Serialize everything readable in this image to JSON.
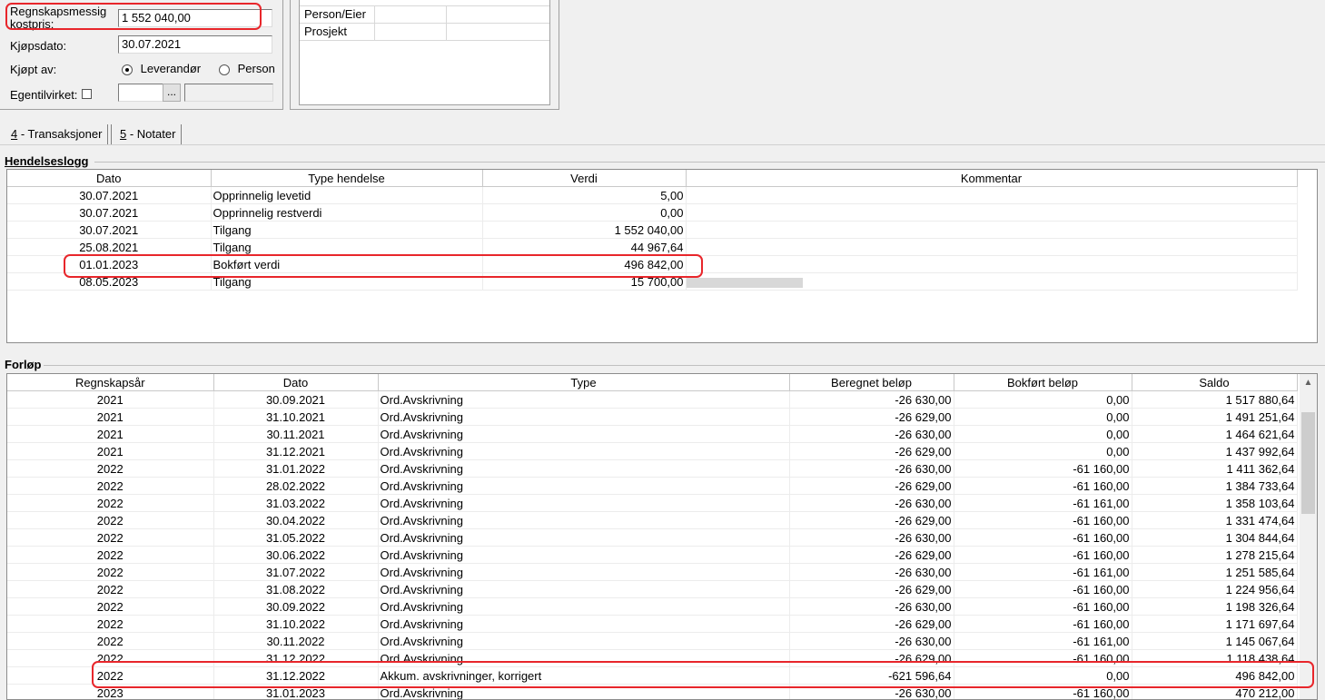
{
  "form": {
    "kostpris_label": "Regnskapsmessig kostpris:",
    "kostpris_value": "1 552 040,00",
    "kjopsdato_label": "Kjøpsdato:",
    "kjopsdato_value": "30.07.2021",
    "kjopt_av_label": "Kjøpt av:",
    "radio_leverandor": "Leverandør",
    "radio_person": "Person",
    "egentilvirket_label": "Egentilvirket:",
    "browse_button": "..."
  },
  "dimensions": {
    "rows": [
      {
        "label": "Person/Eier",
        "value": ""
      },
      {
        "label": "Prosjekt",
        "value": ""
      }
    ]
  },
  "tabs": [
    {
      "key": "4",
      "rest": " - Transaksjoner"
    },
    {
      "key": "5",
      "rest": " - Notater"
    }
  ],
  "hendelseslogg": {
    "title": "Hendelseslogg",
    "columns": [
      "Dato",
      "Type hendelse",
      "Verdi",
      "Kommentar"
    ],
    "rows": [
      {
        "dato": "30.07.2021",
        "type": "Opprinnelig levetid",
        "verdi": "5,00",
        "kommentar": ""
      },
      {
        "dato": "30.07.2021",
        "type": "Opprinnelig restverdi",
        "verdi": "0,00",
        "kommentar": ""
      },
      {
        "dato": "30.07.2021",
        "type": "Tilgang",
        "verdi": "1 552 040,00",
        "kommentar": ""
      },
      {
        "dato": "25.08.2021",
        "type": "Tilgang",
        "verdi": "44 967,64",
        "kommentar": ""
      },
      {
        "dato": "01.01.2023",
        "type": "Bokført verdi",
        "verdi": "496 842,00",
        "kommentar": ""
      },
      {
        "dato": "08.05.2023",
        "type": "Tilgang",
        "verdi": "15 700,00",
        "kommentar": ""
      }
    ]
  },
  "forlop": {
    "title": "Forløp",
    "columns": [
      "Regnskapsår",
      "Dato",
      "Type",
      "Beregnet beløp",
      "Bokført beløp",
      "Saldo"
    ],
    "rows": [
      {
        "ar": "2021",
        "dato": "30.09.2021",
        "type": "Ord.Avskrivning",
        "beregnet": "-26 630,00",
        "bokfort": "0,00",
        "saldo": "1 517 880,64"
      },
      {
        "ar": "2021",
        "dato": "31.10.2021",
        "type": "Ord.Avskrivning",
        "beregnet": "-26 629,00",
        "bokfort": "0,00",
        "saldo": "1 491 251,64"
      },
      {
        "ar": "2021",
        "dato": "30.11.2021",
        "type": "Ord.Avskrivning",
        "beregnet": "-26 630,00",
        "bokfort": "0,00",
        "saldo": "1 464 621,64"
      },
      {
        "ar": "2021",
        "dato": "31.12.2021",
        "type": "Ord.Avskrivning",
        "beregnet": "-26 629,00",
        "bokfort": "0,00",
        "saldo": "1 437 992,64"
      },
      {
        "ar": "2022",
        "dato": "31.01.2022",
        "type": "Ord.Avskrivning",
        "beregnet": "-26 630,00",
        "bokfort": "-61 160,00",
        "saldo": "1 411 362,64"
      },
      {
        "ar": "2022",
        "dato": "28.02.2022",
        "type": "Ord.Avskrivning",
        "beregnet": "-26 629,00",
        "bokfort": "-61 160,00",
        "saldo": "1 384 733,64"
      },
      {
        "ar": "2022",
        "dato": "31.03.2022",
        "type": "Ord.Avskrivning",
        "beregnet": "-26 630,00",
        "bokfort": "-61 161,00",
        "saldo": "1 358 103,64"
      },
      {
        "ar": "2022",
        "dato": "30.04.2022",
        "type": "Ord.Avskrivning",
        "beregnet": "-26 629,00",
        "bokfort": "-61 160,00",
        "saldo": "1 331 474,64"
      },
      {
        "ar": "2022",
        "dato": "31.05.2022",
        "type": "Ord.Avskrivning",
        "beregnet": "-26 630,00",
        "bokfort": "-61 160,00",
        "saldo": "1 304 844,64"
      },
      {
        "ar": "2022",
        "dato": "30.06.2022",
        "type": "Ord.Avskrivning",
        "beregnet": "-26 629,00",
        "bokfort": "-61 160,00",
        "saldo": "1 278 215,64"
      },
      {
        "ar": "2022",
        "dato": "31.07.2022",
        "type": "Ord.Avskrivning",
        "beregnet": "-26 630,00",
        "bokfort": "-61 161,00",
        "saldo": "1 251 585,64"
      },
      {
        "ar": "2022",
        "dato": "31.08.2022",
        "type": "Ord.Avskrivning",
        "beregnet": "-26 629,00",
        "bokfort": "-61 160,00",
        "saldo": "1 224 956,64"
      },
      {
        "ar": "2022",
        "dato": "30.09.2022",
        "type": "Ord.Avskrivning",
        "beregnet": "-26 630,00",
        "bokfort": "-61 160,00",
        "saldo": "1 198 326,64"
      },
      {
        "ar": "2022",
        "dato": "31.10.2022",
        "type": "Ord.Avskrivning",
        "beregnet": "-26 629,00",
        "bokfort": "-61 160,00",
        "saldo": "1 171 697,64"
      },
      {
        "ar": "2022",
        "dato": "30.11.2022",
        "type": "Ord.Avskrivning",
        "beregnet": "-26 630,00",
        "bokfort": "-61 161,00",
        "saldo": "1 145 067,64"
      },
      {
        "ar": "2022",
        "dato": "31.12.2022",
        "type": "Ord.Avskrivning",
        "beregnet": "-26 629,00",
        "bokfort": "-61 160,00",
        "saldo": "1 118 438,64"
      },
      {
        "ar": "2022",
        "dato": "31.12.2022",
        "type": "Akkum. avskrivninger, korrigert",
        "beregnet": "-621 596,64",
        "bokfort": "0,00",
        "saldo": "496 842,00"
      },
      {
        "ar": "2023",
        "dato": "31.01.2023",
        "type": "Ord.Avskrivning",
        "beregnet": "-26 630,00",
        "bokfort": "-61 160,00",
        "saldo": "470 212,00"
      }
    ]
  },
  "colors": {
    "highlight": "#e8262b"
  }
}
